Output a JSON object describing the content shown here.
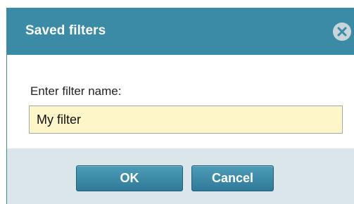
{
  "dialog": {
    "title": "Saved filters",
    "close_icon": "close-circle-icon",
    "prompt_label": "Enter filter name:",
    "filter_name_value": "My filter",
    "ok_label": "OK",
    "cancel_label": "Cancel"
  },
  "colors": {
    "titlebar": "#3b8aa6",
    "input_background": "#fdf6c9",
    "footer": "#dbe6ea",
    "button": "#2f7a98"
  }
}
